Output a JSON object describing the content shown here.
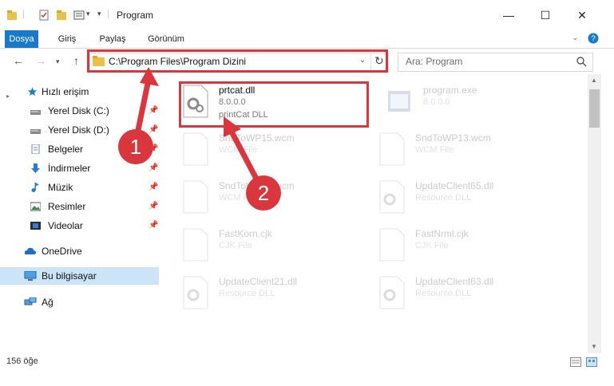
{
  "window": {
    "title": "Program",
    "minimize_label": "—",
    "maximize_label": "☐",
    "close_label": "✕"
  },
  "ribbon": {
    "tabs": [
      "Dosya",
      "Giriş",
      "Paylaş",
      "Görünüm"
    ],
    "expand_icon": "chevron-down-icon",
    "help_icon": "help-icon"
  },
  "nav": {
    "address": "C:\\Program Files\\Program Dizini",
    "search_placeholder": "Ara: Program"
  },
  "sidebar": {
    "quick_access": "Hızlı erişim",
    "items": [
      {
        "label": "Yerel Disk (C:)",
        "icon": "drive-icon",
        "pinned": true
      },
      {
        "label": "Yerel Disk (D:)",
        "icon": "drive-icon",
        "pinned": true
      },
      {
        "label": "Belgeler",
        "icon": "documents-icon",
        "pinned": true
      },
      {
        "label": "İndirmeler",
        "icon": "downloads-icon",
        "pinned": true
      },
      {
        "label": "Müzik",
        "icon": "music-icon",
        "pinned": true
      },
      {
        "label": "Resimler",
        "icon": "pictures-icon",
        "pinned": true
      },
      {
        "label": "Videolar",
        "icon": "videos-icon",
        "pinned": true
      }
    ],
    "onedrive": "OneDrive",
    "this_pc": "Bu bilgisayar",
    "network": "Ağ"
  },
  "files": [
    {
      "name": "prtcat.dll",
      "line2": "8.0.0.0",
      "line3": "printCat DLL",
      "highlighted": true
    },
    {
      "name": "program.exe",
      "line2": "8.0.0.0",
      "line3": "",
      "highlighted": false
    },
    {
      "name": "SndToWP15.wcm",
      "line2": "WCM File",
      "line3": "",
      "highlighted": false
    },
    {
      "name": "SndToWP13.wcm",
      "line2": "WCM File",
      "line3": "",
      "highlighted": false
    },
    {
      "name": "SndToWP14.wcm",
      "line2": "WCM File",
      "line3": "",
      "highlighted": false
    },
    {
      "name": "UpdateClient65.dll",
      "line2": "Resource DLL",
      "line3": "",
      "highlighted": false
    },
    {
      "name": "FastKorn.cjk",
      "line2": "CJK File",
      "line3": "",
      "highlighted": false
    },
    {
      "name": "FastNrml.cjk",
      "line2": "CJK File",
      "line3": "",
      "highlighted": false
    },
    {
      "name": "UpdateClient21.dll",
      "line2": "Resource DLL",
      "line3": "",
      "highlighted": false
    },
    {
      "name": "UpdateClient63.dll",
      "line2": "Resource DLL",
      "line3": "",
      "highlighted": false
    }
  ],
  "status": {
    "count": "156 öğe"
  },
  "annotations": {
    "step1": "1",
    "step2": "2",
    "color": "#d9363e"
  }
}
